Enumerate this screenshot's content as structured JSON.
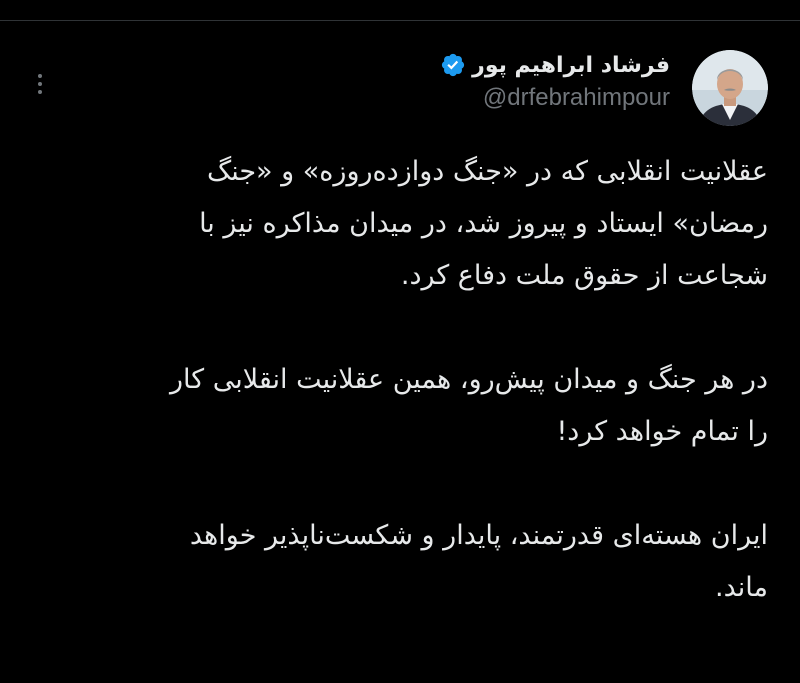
{
  "theme": {
    "background": "#000000",
    "text": "#e7e9ea",
    "secondary_text": "#71767b",
    "verified_badge": "#1d9bf0"
  },
  "tweet": {
    "author": {
      "display_name": "فرشاد ابراهیم پور",
      "handle": "@drfebrahimpour",
      "verified": true,
      "avatar_icon": "profile-photo"
    },
    "more_menu_icon": "vertical-ellipsis-icon",
    "paragraphs": [
      [
        "عقلانیت انقلابی که در «جنگ دوازده‌روزه» و «جنگ",
        "رمضان» ایستاد و پیروز شد، در میدان مذاکره نیز با",
        "شجاعت از حقوق ملت دفاع کرد."
      ],
      [
        "در هر جنگ و میدان پیش‌رو، همین عقلانیت انقلابی کار",
        "را تمام خواهد کرد!"
      ],
      [
        "ایران هسته‌ای قدرتمند، پایدار و شکست‌ناپذیر خواهد",
        "ماند."
      ]
    ]
  }
}
